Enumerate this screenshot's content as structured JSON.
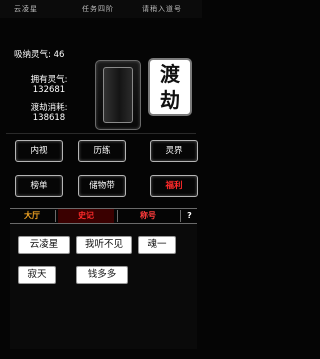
{
  "top_bar": {
    "items": [
      "云凌星",
      "任务四阶",
      "请稍入道号"
    ]
  },
  "stats": {
    "absorb_line": "吸纳灵气: 46",
    "owned_label": "拥有灵气:",
    "owned_value": "132681",
    "cost_label": "渡劫消耗:",
    "cost_value": "138618"
  },
  "tribulation_button": {
    "char1": "渡",
    "char2": "劫"
  },
  "menu": {
    "row1": [
      "内视",
      "历练",
      "灵界"
    ],
    "row2": [
      "榜单",
      "储物带",
      "福利"
    ]
  },
  "chat_tabs": {
    "tabs": [
      "大厅",
      "史记",
      "称号"
    ],
    "help": "?",
    "colors": {
      "hall": "#f5a623",
      "history": "#ff2a2a",
      "title": "#ff3b3b",
      "help": "#ffffff"
    }
  },
  "players": [
    "云凌星",
    "我听不见",
    "魂一",
    "寂天",
    "钱多多"
  ]
}
